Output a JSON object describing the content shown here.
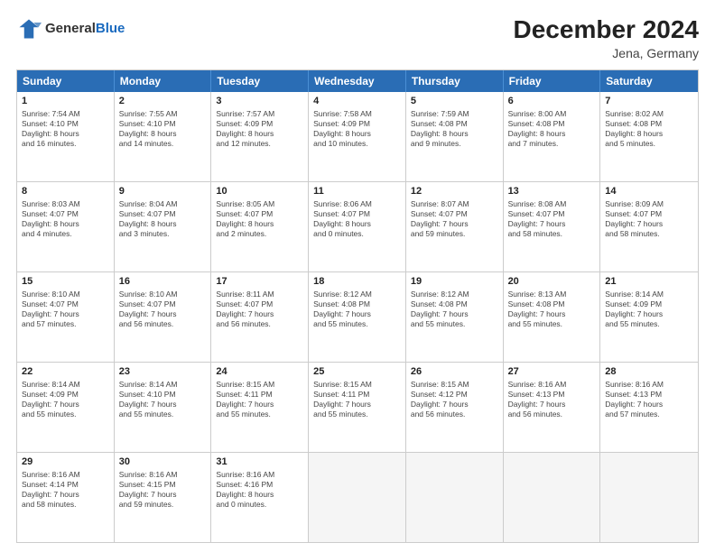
{
  "header": {
    "logo_general": "General",
    "logo_blue": "Blue",
    "month_year": "December 2024",
    "location": "Jena, Germany"
  },
  "weekdays": [
    "Sunday",
    "Monday",
    "Tuesday",
    "Wednesday",
    "Thursday",
    "Friday",
    "Saturday"
  ],
  "weeks": [
    [
      {
        "day": "1",
        "info": "Sunrise: 7:54 AM\nSunset: 4:10 PM\nDaylight: 8 hours\nand 16 minutes."
      },
      {
        "day": "2",
        "info": "Sunrise: 7:55 AM\nSunset: 4:10 PM\nDaylight: 8 hours\nand 14 minutes."
      },
      {
        "day": "3",
        "info": "Sunrise: 7:57 AM\nSunset: 4:09 PM\nDaylight: 8 hours\nand 12 minutes."
      },
      {
        "day": "4",
        "info": "Sunrise: 7:58 AM\nSunset: 4:09 PM\nDaylight: 8 hours\nand 10 minutes."
      },
      {
        "day": "5",
        "info": "Sunrise: 7:59 AM\nSunset: 4:08 PM\nDaylight: 8 hours\nand 9 minutes."
      },
      {
        "day": "6",
        "info": "Sunrise: 8:00 AM\nSunset: 4:08 PM\nDaylight: 8 hours\nand 7 minutes."
      },
      {
        "day": "7",
        "info": "Sunrise: 8:02 AM\nSunset: 4:08 PM\nDaylight: 8 hours\nand 5 minutes."
      }
    ],
    [
      {
        "day": "8",
        "info": "Sunrise: 8:03 AM\nSunset: 4:07 PM\nDaylight: 8 hours\nand 4 minutes."
      },
      {
        "day": "9",
        "info": "Sunrise: 8:04 AM\nSunset: 4:07 PM\nDaylight: 8 hours\nand 3 minutes."
      },
      {
        "day": "10",
        "info": "Sunrise: 8:05 AM\nSunset: 4:07 PM\nDaylight: 8 hours\nand 2 minutes."
      },
      {
        "day": "11",
        "info": "Sunrise: 8:06 AM\nSunset: 4:07 PM\nDaylight: 8 hours\nand 0 minutes."
      },
      {
        "day": "12",
        "info": "Sunrise: 8:07 AM\nSunset: 4:07 PM\nDaylight: 7 hours\nand 59 minutes."
      },
      {
        "day": "13",
        "info": "Sunrise: 8:08 AM\nSunset: 4:07 PM\nDaylight: 7 hours\nand 58 minutes."
      },
      {
        "day": "14",
        "info": "Sunrise: 8:09 AM\nSunset: 4:07 PM\nDaylight: 7 hours\nand 58 minutes."
      }
    ],
    [
      {
        "day": "15",
        "info": "Sunrise: 8:10 AM\nSunset: 4:07 PM\nDaylight: 7 hours\nand 57 minutes."
      },
      {
        "day": "16",
        "info": "Sunrise: 8:10 AM\nSunset: 4:07 PM\nDaylight: 7 hours\nand 56 minutes."
      },
      {
        "day": "17",
        "info": "Sunrise: 8:11 AM\nSunset: 4:07 PM\nDaylight: 7 hours\nand 56 minutes."
      },
      {
        "day": "18",
        "info": "Sunrise: 8:12 AM\nSunset: 4:08 PM\nDaylight: 7 hours\nand 55 minutes."
      },
      {
        "day": "19",
        "info": "Sunrise: 8:12 AM\nSunset: 4:08 PM\nDaylight: 7 hours\nand 55 minutes."
      },
      {
        "day": "20",
        "info": "Sunrise: 8:13 AM\nSunset: 4:08 PM\nDaylight: 7 hours\nand 55 minutes."
      },
      {
        "day": "21",
        "info": "Sunrise: 8:14 AM\nSunset: 4:09 PM\nDaylight: 7 hours\nand 55 minutes."
      }
    ],
    [
      {
        "day": "22",
        "info": "Sunrise: 8:14 AM\nSunset: 4:09 PM\nDaylight: 7 hours\nand 55 minutes."
      },
      {
        "day": "23",
        "info": "Sunrise: 8:14 AM\nSunset: 4:10 PM\nDaylight: 7 hours\nand 55 minutes."
      },
      {
        "day": "24",
        "info": "Sunrise: 8:15 AM\nSunset: 4:11 PM\nDaylight: 7 hours\nand 55 minutes."
      },
      {
        "day": "25",
        "info": "Sunrise: 8:15 AM\nSunset: 4:11 PM\nDaylight: 7 hours\nand 55 minutes."
      },
      {
        "day": "26",
        "info": "Sunrise: 8:15 AM\nSunset: 4:12 PM\nDaylight: 7 hours\nand 56 minutes."
      },
      {
        "day": "27",
        "info": "Sunrise: 8:16 AM\nSunset: 4:13 PM\nDaylight: 7 hours\nand 56 minutes."
      },
      {
        "day": "28",
        "info": "Sunrise: 8:16 AM\nSunset: 4:13 PM\nDaylight: 7 hours\nand 57 minutes."
      }
    ],
    [
      {
        "day": "29",
        "info": "Sunrise: 8:16 AM\nSunset: 4:14 PM\nDaylight: 7 hours\nand 58 minutes."
      },
      {
        "day": "30",
        "info": "Sunrise: 8:16 AM\nSunset: 4:15 PM\nDaylight: 7 hours\nand 59 minutes."
      },
      {
        "day": "31",
        "info": "Sunrise: 8:16 AM\nSunset: 4:16 PM\nDaylight: 8 hours\nand 0 minutes."
      },
      {
        "day": "",
        "info": ""
      },
      {
        "day": "",
        "info": ""
      },
      {
        "day": "",
        "info": ""
      },
      {
        "day": "",
        "info": ""
      }
    ]
  ]
}
